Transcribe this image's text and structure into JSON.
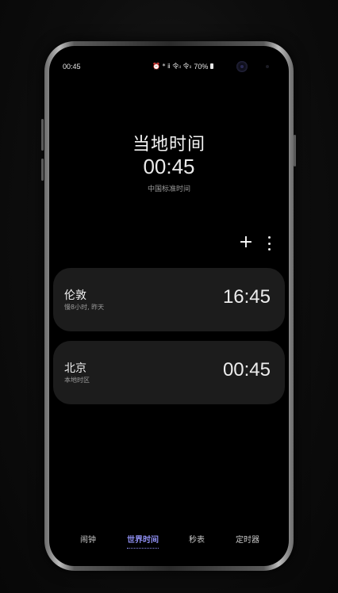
{
  "status_bar": {
    "time": "00:45",
    "icons": "⏰ * ⅱ 令ᵢₗ 令ᵢₗ",
    "battery": "70%"
  },
  "header": {
    "title": "当地时间",
    "time": "00:45",
    "zone": "中国标准时间"
  },
  "actions": {
    "add_label": "+",
    "more_icon": "more-vertical-icon"
  },
  "cities": [
    {
      "name": "伦敦",
      "sub": "慢8小时, 昨天",
      "time": "16:45"
    },
    {
      "name": "北京",
      "sub": "本地时区",
      "time": "00:45"
    }
  ],
  "nav": {
    "tabs": [
      {
        "label": "闹钟",
        "active": false
      },
      {
        "label": "世界时间",
        "active": true
      },
      {
        "label": "秒表",
        "active": false
      },
      {
        "label": "定时器",
        "active": false
      }
    ]
  },
  "colors": {
    "background": "#000000",
    "card": "#1c1c1c",
    "accent": "#8f8ff2",
    "text_primary": "#f2f2f2",
    "text_secondary": "#9b9b9b"
  }
}
